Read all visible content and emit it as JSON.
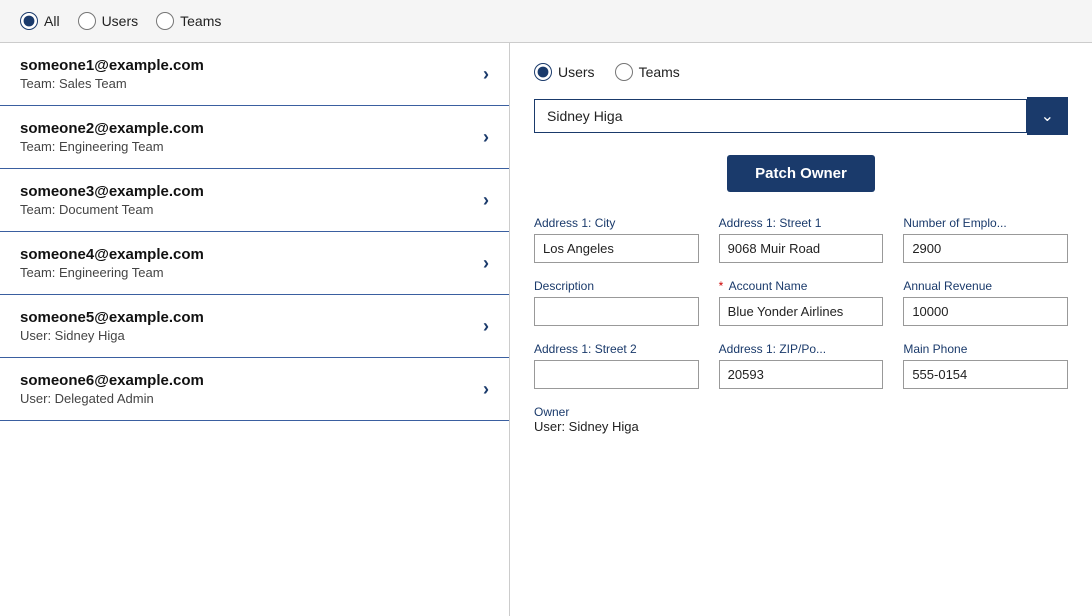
{
  "topFilter": {
    "options": [
      {
        "id": "all",
        "label": "All",
        "checked": true
      },
      {
        "id": "users",
        "label": "Users",
        "checked": false
      },
      {
        "id": "teams",
        "label": "Teams",
        "checked": false
      }
    ]
  },
  "listItems": [
    {
      "email": "someone1@example.com",
      "sub": "Team: Sales Team"
    },
    {
      "email": "someone2@example.com",
      "sub": "Team: Engineering Team"
    },
    {
      "email": "someone3@example.com",
      "sub": "Team: Document Team"
    },
    {
      "email": "someone4@example.com",
      "sub": "Team: Engineering Team"
    },
    {
      "email": "someone5@example.com",
      "sub": "User: Sidney Higa"
    },
    {
      "email": "someone6@example.com",
      "sub": "User: Delegated Admin"
    }
  ],
  "rightPanel": {
    "radioOptions": [
      {
        "id": "r-users",
        "label": "Users",
        "checked": true
      },
      {
        "id": "r-teams",
        "label": "Teams",
        "checked": false
      }
    ],
    "dropdown": {
      "value": "Sidney Higa",
      "placeholder": "Sidney Higa"
    },
    "patchOwnerLabel": "Patch Owner",
    "fields": [
      {
        "label": "Address 1: City",
        "value": "Los Angeles",
        "required": false,
        "col": 1
      },
      {
        "label": "Address 1: Street 1",
        "value": "9068 Muir Road",
        "required": false,
        "col": 2
      },
      {
        "label": "Number of Emplo...",
        "value": "2900",
        "required": false,
        "col": 3
      },
      {
        "label": "Description",
        "value": "",
        "required": false,
        "col": 1
      },
      {
        "label": "Account Name",
        "value": "Blue Yonder Airlines",
        "required": true,
        "col": 2
      },
      {
        "label": "Annual Revenue",
        "value": "10000",
        "required": false,
        "col": 3
      },
      {
        "label": "Address 1: Street 2",
        "value": "",
        "required": false,
        "col": 1
      },
      {
        "label": "Address 1: ZIP/Po...",
        "value": "20593",
        "required": false,
        "col": 2
      },
      {
        "label": "Main Phone",
        "value": "555-0154",
        "required": false,
        "col": 3
      }
    ],
    "owner": {
      "label": "Owner",
      "value": "User: Sidney Higa"
    }
  }
}
